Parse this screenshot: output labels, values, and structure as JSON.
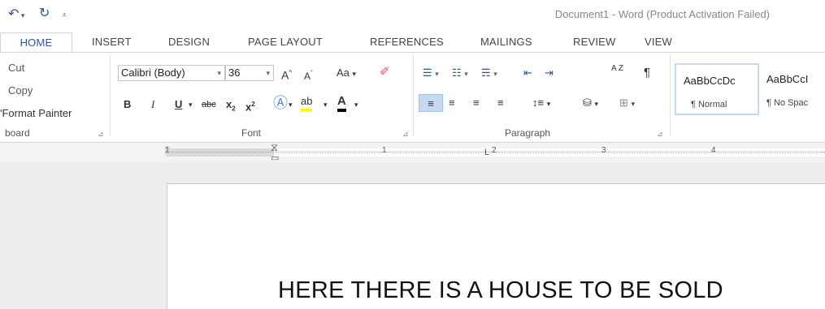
{
  "quick_access": {
    "undo_icon": "undo-icon",
    "redo_icon": "redo-icon",
    "customize_icon": "customize-qat-icon"
  },
  "window": {
    "title": "Document1 - Word (Product Activation Failed)"
  },
  "tabs": [
    {
      "label": "HOME",
      "active": true
    },
    {
      "label": "INSERT"
    },
    {
      "label": "DESIGN"
    },
    {
      "label": "PAGE LAYOUT"
    },
    {
      "label": "REFERENCES"
    },
    {
      "label": "MAILINGS"
    },
    {
      "label": "REVIEW"
    },
    {
      "label": "VIEW"
    }
  ],
  "clipboard": {
    "cut": "Cut",
    "copy": "Copy",
    "format_painter": "Format Painter",
    "group_label": "board"
  },
  "font": {
    "name": "Calibri (Body)",
    "size": "36",
    "change_case": "Aa",
    "bold": "B",
    "italic": "I",
    "underline": "U",
    "strikethrough": "abc",
    "subscript": "x",
    "superscript": "x",
    "group_label": "Font"
  },
  "paragraph": {
    "sort": "A Z",
    "pilcrow": "¶",
    "group_label": "Paragraph"
  },
  "styles": [
    {
      "sample": "AaBbCcDc",
      "name": "¶ Normal",
      "selected": true
    },
    {
      "sample": "AaBbCcI",
      "name": "¶ No Spac"
    }
  ],
  "ruler": {
    "labels": [
      "1",
      "1",
      "2",
      "3",
      "4"
    ]
  },
  "document": {
    "headline": "HERE THERE IS A HOUSE TO BE SOLD"
  },
  "colors": {
    "accent": "#2b579a",
    "highlight": "#ffff00",
    "font_color": "#000000",
    "doc_bg": "#ededed"
  }
}
